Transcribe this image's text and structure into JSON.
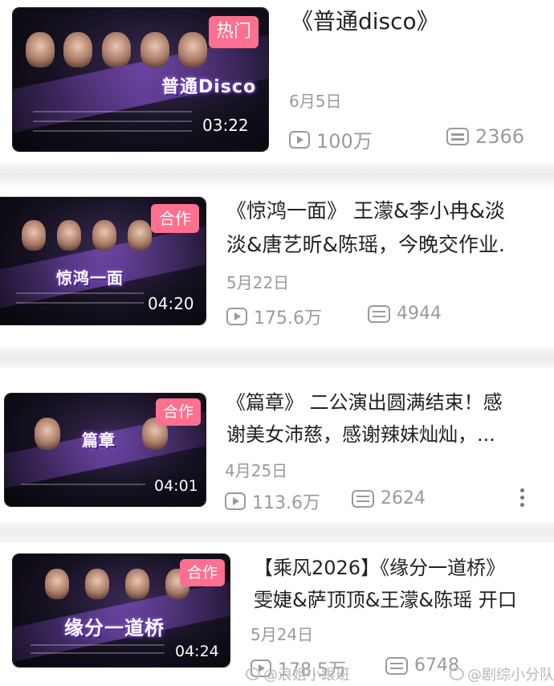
{
  "videos": [
    {
      "tag": "热门",
      "thumb_title": "普通Disco",
      "duration": "03:22",
      "title": "《普通disco》",
      "date": "6月5日",
      "views": "100万",
      "danmaku": "2366"
    },
    {
      "tag": "合作",
      "thumb_title": "惊鸿一面",
      "duration": "04:20",
      "title_line1": "《惊鸿一面》 王濛&李小冉&淡",
      "title_line2": "淡&唐艺昕&陈瑶，今晚交作业.",
      "date": "5月22日",
      "views": "175.6万",
      "danmaku": "4944"
    },
    {
      "tag": "合作",
      "thumb_title": "篇章",
      "duration": "04:01",
      "title_line1": "《篇章》 二公演出圆满结束！感",
      "title_line2": "谢美女沛慈，感谢辣妹灿灿，...",
      "date": "4月25日",
      "views": "113.6万",
      "danmaku": "2624"
    },
    {
      "tag": "合作",
      "thumb_title": "缘分一道桥",
      "duration": "04:24",
      "title_line1": "【乘风2026】《缘分一道桥》",
      "title_line2": "雯婕&萨顶顶&王濛&陈瑶 开口",
      "date": "5月24日",
      "views": "178.5万",
      "danmaku": "6748"
    }
  ],
  "watermarks": {
    "left": "@浪姐小跟班",
    "right": "@剧综小分队"
  }
}
